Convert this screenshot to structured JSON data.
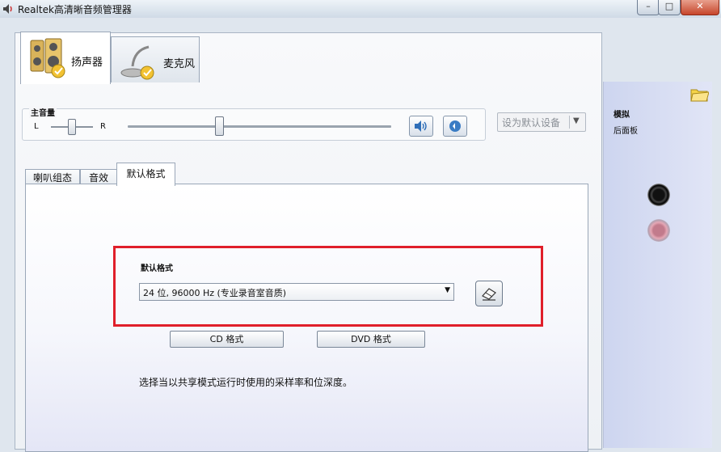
{
  "window": {
    "title": "Realtek高清晰音频管理器",
    "buttons": {
      "minimize": "–",
      "maximize": "□",
      "close": "✕"
    }
  },
  "device_tabs": [
    {
      "label": "扬声器",
      "icon": "speaker-icon",
      "selected": true
    },
    {
      "label": "麦克风",
      "icon": "microphone-icon",
      "selected": false
    }
  ],
  "master_volume": {
    "title": "主音量",
    "balance_left": "L",
    "balance_right": "R",
    "balance_level": 0.5,
    "volume_level": 0.35
  },
  "set_default_device": {
    "label": "设为默认设备",
    "disabled": true
  },
  "inner_tabs": [
    {
      "label": "喇叭组态",
      "selected": false
    },
    {
      "label": "音效",
      "selected": false
    },
    {
      "label": "默认格式",
      "selected": true
    }
  ],
  "default_format": {
    "label": "默认格式",
    "selected_value": "24 位, 96000 Hz (专业录音室音质)",
    "cd_button": "CD 格式",
    "dvd_button": "DVD 格式",
    "description": "选择当以共享模式运行时使用的采样率和位深度。"
  },
  "side_panel": {
    "title": "模拟",
    "subtitle": "后面板",
    "jacks": [
      "black",
      "pink"
    ]
  },
  "colors": {
    "highlight_border": "#e01f2a",
    "side_panel": "#d6dcf2"
  }
}
